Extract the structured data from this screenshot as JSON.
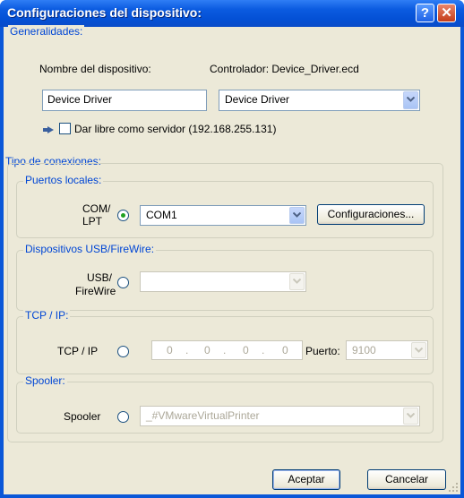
{
  "window": {
    "title": "Configuraciones del dispositivo:",
    "help_glyph": "?",
    "close_glyph": "✕"
  },
  "general": {
    "legend": "Generalidades:",
    "device_name_label": "Nombre del dispositivo:",
    "driver_label": "Controlador:  Device_Driver.ecd",
    "device_name_value": "Device Driver",
    "driver_select_value": "Device Driver",
    "share_label": "Dar libre como servidor (192.168.255.131)",
    "share_checked": false
  },
  "connections": {
    "legend": "Tipo de conexiones:",
    "local_ports": {
      "legend": "Puertos locales:",
      "radio_label_line1": "COM/",
      "radio_label_line2": "LPT",
      "selected": true,
      "port_value": "COM1",
      "config_button": "Configuraciones..."
    },
    "usb": {
      "legend": "Dispositivos USB/FireWire:",
      "radio_label_line1": "USB/",
      "radio_label_line2": "FireWire",
      "selected": false,
      "value": ""
    },
    "tcp": {
      "legend": "TCP / IP:",
      "radio_label": "TCP / IP",
      "selected": false,
      "ip": [
        "0",
        "0",
        "0",
        "0"
      ],
      "ip_sep": ".",
      "port_label": "Puerto:",
      "port_value": "9100"
    },
    "spooler": {
      "legend": "Spooler:",
      "radio_label": "Spooler",
      "selected": false,
      "value": "_#VMwareVirtualPrinter"
    }
  },
  "buttons": {
    "accept": "Aceptar",
    "cancel": "Cancelar"
  },
  "colors": {
    "title_bar": "#0a57d8",
    "legend_text": "#0046d5",
    "dialog_bg": "#ece9d8",
    "radio_dot": "#21a121"
  }
}
